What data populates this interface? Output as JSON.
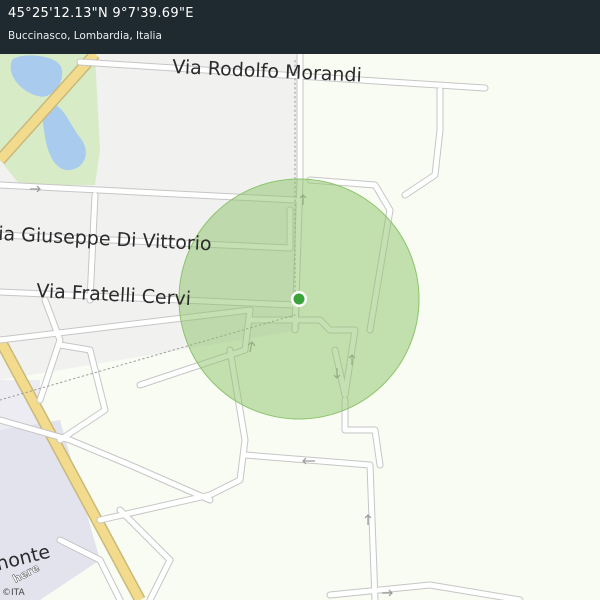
{
  "header": {
    "coordinates": "45°25'12.13\"N 9°7'39.69\"E",
    "location": "Buccinasco, Lombardia, Italia"
  },
  "map": {
    "streets": {
      "morandi": "Via Rodolfo Morandi",
      "vittorio": "ia Giuseppe Di Vittorio",
      "cervi": "Via Fratelli Cervi",
      "monte": "nonte"
    },
    "brand": "here",
    "copyright": "©ITA"
  },
  "colors": {
    "header_bg": "#1f2a30",
    "accuracy_circle": "#8cc36a",
    "location_dot": "#3aa43a",
    "water": "#a9cbee",
    "park": "#d8ebc7",
    "road": "#ffffff",
    "road_edge": "#c9c9c9",
    "highway": "#f3db8e"
  },
  "icons": [
    "location-dot-icon",
    "here-logo"
  ]
}
